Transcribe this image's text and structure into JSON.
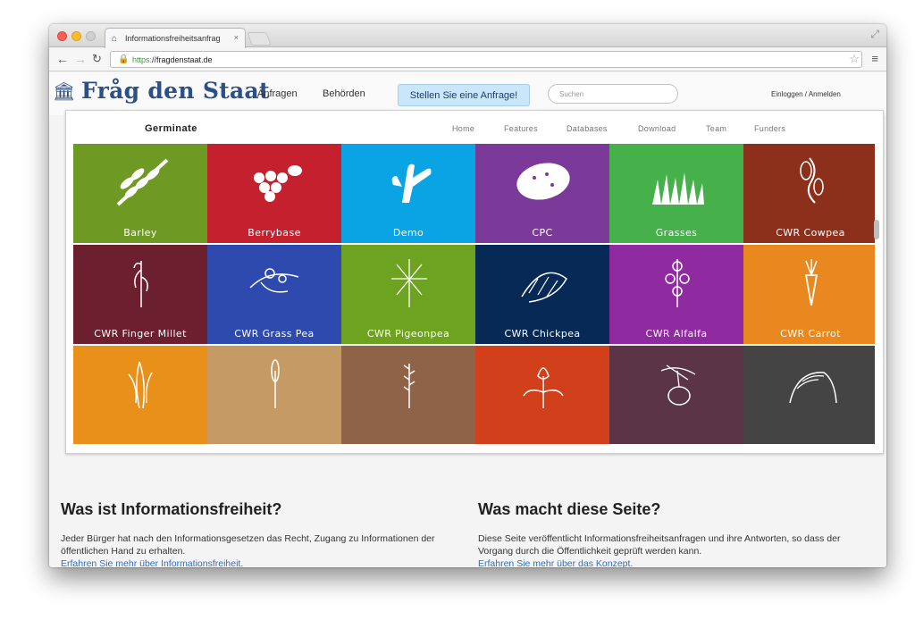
{
  "browser": {
    "tab_title": "Informationsfreiheitsanfrag",
    "tab_close": "×",
    "url_scheme": "https:",
    "url_rest": "//fragdenstaat.de",
    "icons": [
      "back-icon",
      "forward-icon",
      "reload-icon",
      "lock-icon",
      "star-icon",
      "menu-icon"
    ]
  },
  "site": {
    "logo": "Fråg den Staat",
    "nav": [
      "Anfragen",
      "Behörden"
    ],
    "cta": "Stellen Sie eine Anfrage!",
    "search_placeholder": "Suchen",
    "login": "Einloggen / Anmelden"
  },
  "app": {
    "brand": "Germinate",
    "links": [
      "Home",
      "Features",
      "Databases",
      "Download",
      "Team",
      "Funders"
    ],
    "tiles": [
      {
        "label": "Barley",
        "color": "#6e9a24",
        "icon": "grain-icon"
      },
      {
        "label": "Berrybase",
        "color": "#c5202e",
        "icon": "berries-icon"
      },
      {
        "label": "Demo",
        "color": "#0aa3e3",
        "icon": "cactus-icon"
      },
      {
        "label": "CPC",
        "color": "#7b3a9a",
        "icon": "potato-icon"
      },
      {
        "label": "Grasses",
        "color": "#46b04a",
        "icon": "grass-icon"
      },
      {
        "label": "CWR Cowpea",
        "color": "#8c2f1b",
        "icon": "cowpea-icon"
      },
      {
        "label": "CWR Finger Millet",
        "color": "#6c1f2e",
        "icon": "millet-icon"
      },
      {
        "label": "CWR Grass Pea",
        "color": "#2e4aae",
        "icon": "grasspea-icon"
      },
      {
        "label": "CWR Pigeonpea",
        "color": "#6ea221",
        "icon": "pigeonpea-icon"
      },
      {
        "label": "CWR Chickpea",
        "color": "#062a55",
        "icon": "chickpea-icon"
      },
      {
        "label": "CWR Alfalfa",
        "color": "#8f2aa1",
        "icon": "alfalfa-icon"
      },
      {
        "label": "CWR Carrot",
        "color": "#ea8820",
        "icon": "carrot-icon"
      },
      {
        "label": "",
        "color": "#e8901a",
        "icon": "maize-icon"
      },
      {
        "label": "",
        "color": "#c59a64",
        "icon": "wheat-icon"
      },
      {
        "label": "",
        "color": "#8f6348",
        "icon": "oat-icon"
      },
      {
        "label": "",
        "color": "#d2401b",
        "icon": "flower-icon"
      },
      {
        "label": "",
        "color": "#5b3545",
        "icon": "eggplant-icon"
      },
      {
        "label": "",
        "color": "#444444",
        "icon": "rice-icon"
      }
    ]
  },
  "info": {
    "heading_left": "Was ist Informationsfreiheit?",
    "text_left": "Jeder Bürger hat nach den Informationsgesetzen das Recht, Zugang zu Informationen der öffentlichen Hand zu erhalten.",
    "link_left": "Erfahren Sie mehr über Informationsfreiheit.",
    "heading_right": "Was macht diese Seite?",
    "text_right": "Diese Seite veröffentlicht Informationsfreiheitsanfragen und ihre Antworten, so dass der Vorgang durch die Öffentlichkeit geprüft werden kann.",
    "link_right": "Erfahren Sie mehr über das Konzept."
  }
}
